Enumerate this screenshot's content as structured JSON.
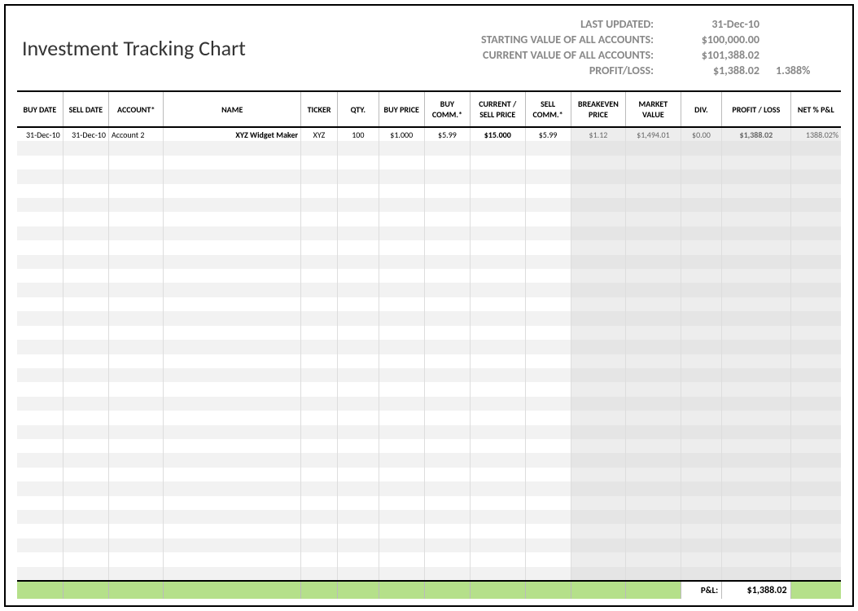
{
  "title": "Investment Tracking Chart",
  "summary": {
    "last_updated_label": "LAST UPDATED:",
    "last_updated_value": "31-Dec-10",
    "starting_value_label": "STARTING VALUE OF ALL ACCOUNTS:",
    "starting_value": "$100,000.00",
    "current_value_label": "CURRENT VALUE OF ALL ACCOUNTS:",
    "current_value": "$101,388.02",
    "profit_loss_label": "PROFIT/LOSS:",
    "profit_loss_value": "$1,388.02",
    "profit_loss_pct": "1.388%"
  },
  "headers": {
    "buy_date": "BUY DATE",
    "sell_date": "SELL DATE",
    "account": "ACCOUNT*",
    "name": "NAME",
    "ticker": "TICKER",
    "qty": "QTY.",
    "buy_price": "BUY PRICE",
    "buy_comm": "BUY COMM.*",
    "current_sell": "CURRENT / SELL PRICE",
    "sell_comm": "SELL COMM.*",
    "breakeven": "BREAKEVEN PRICE",
    "market": "MARKET VALUE",
    "div": "DIV.",
    "profit_loss": "PROFIT / LOSS",
    "net_pl": "NET % P&L"
  },
  "rows": [
    {
      "buy_date": "31-Dec-10",
      "sell_date": "31-Dec-10",
      "account": "Account 2",
      "name": "XYZ Widget Maker",
      "ticker": "XYZ",
      "qty": "100",
      "buy_price": "$1.000",
      "buy_comm": "$5.99",
      "current_sell": "$15.000",
      "sell_comm": "$5.99",
      "breakeven": "$1.12",
      "market": "$1,494.01",
      "div": "$0.00",
      "profit_loss": "$1,388.02",
      "net_pl": "1388.02%"
    }
  ],
  "footer": {
    "pl_label": "P&L:",
    "pl_value": "$1,388.02"
  }
}
